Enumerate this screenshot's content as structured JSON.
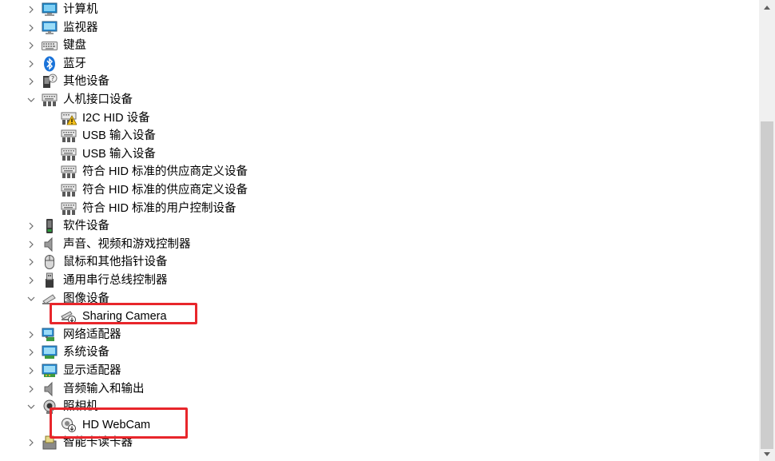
{
  "tree": {
    "items": [
      {
        "label": "计算机",
        "icon": "computer-icon",
        "expanded": false,
        "level": 0
      },
      {
        "label": "监视器",
        "icon": "monitor-icon",
        "expanded": false,
        "level": 0
      },
      {
        "label": "键盘",
        "icon": "keyboard-icon",
        "expanded": false,
        "level": 0
      },
      {
        "label": "蓝牙",
        "icon": "bluetooth-icon",
        "expanded": false,
        "level": 0
      },
      {
        "label": "其他设备",
        "icon": "unknown-device-icon",
        "expanded": false,
        "level": 0
      },
      {
        "label": "人机接口设备",
        "icon": "hid-icon",
        "expanded": true,
        "level": 0
      },
      {
        "label": "I2C HID 设备",
        "icon": "hid-warning-icon",
        "level": 1
      },
      {
        "label": "USB 输入设备",
        "icon": "hid-icon",
        "level": 1
      },
      {
        "label": "USB 输入设备",
        "icon": "hid-icon",
        "level": 1
      },
      {
        "label": "符合 HID 标准的供应商定义设备",
        "icon": "hid-icon",
        "level": 1
      },
      {
        "label": "符合 HID 标准的供应商定义设备",
        "icon": "hid-icon",
        "level": 1
      },
      {
        "label": "符合 HID 标准的用户控制设备",
        "icon": "hid-icon",
        "level": 1
      },
      {
        "label": "软件设备",
        "icon": "software-device-icon",
        "expanded": false,
        "level": 0
      },
      {
        "label": "声音、视频和游戏控制器",
        "icon": "speaker-icon",
        "expanded": false,
        "level": 0
      },
      {
        "label": "鼠标和其他指针设备",
        "icon": "mouse-icon",
        "expanded": false,
        "level": 0
      },
      {
        "label": "通用串行总线控制器",
        "icon": "usb-icon",
        "expanded": false,
        "level": 0
      },
      {
        "label": "图像设备",
        "icon": "imaging-device-icon",
        "expanded": true,
        "level": 0
      },
      {
        "label": "Sharing Camera",
        "icon": "camera-disabled-icon",
        "level": 1
      },
      {
        "label": "网络适配器",
        "icon": "network-adapter-icon",
        "expanded": false,
        "level": 0
      },
      {
        "label": "系统设备",
        "icon": "system-device-icon",
        "expanded": false,
        "level": 0
      },
      {
        "label": "显示适配器",
        "icon": "display-adapter-icon",
        "expanded": false,
        "level": 0
      },
      {
        "label": "音频输入和输出",
        "icon": "speaker-icon",
        "expanded": false,
        "level": 0
      },
      {
        "label": "照相机",
        "icon": "webcam-icon",
        "expanded": true,
        "level": 0
      },
      {
        "label": "HD WebCam",
        "icon": "webcam-disabled-icon",
        "level": 1
      },
      {
        "label": "智能卡读卡器",
        "icon": "smart-card-reader-icon",
        "expanded": false,
        "level": 0
      }
    ]
  },
  "colors": {
    "highlight": "#e8262b",
    "chevron": "#6b6b6b",
    "scrollbar_thumb": "#cdcdcd"
  }
}
